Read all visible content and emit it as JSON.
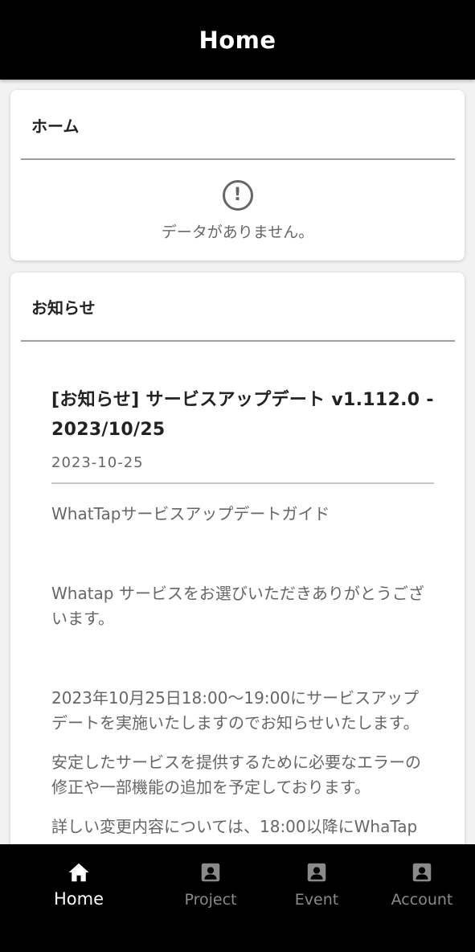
{
  "header": {
    "title": "Home"
  },
  "home_card": {
    "title": "ホーム",
    "empty_icon": "alert-circle-icon",
    "empty_text": "データがありません。"
  },
  "notice_card": {
    "title": "お知らせ",
    "item": {
      "title": "[お知らせ] サービスアップデート v1.112.0 - 2023/10/25",
      "date": "2023-10-25",
      "body": [
        "WhatTapサービスアップデートガイド",
        "Whatap サービスをお選びいただきありがとうございます。",
        "2023年10月25日18:00～19:00にサービスアップデートを実施いたしますのでお知らせいたします。",
        "安定したサービスを提供するために必要なエラーの修正や一部機能の追加を予定しております。",
        "詳しい変更内容については、18:00以降にWhaTap"
      ]
    }
  },
  "bottom_nav": {
    "items": [
      {
        "label": "Home",
        "icon": "home-icon",
        "active": true
      },
      {
        "label": "Project",
        "icon": "account-box-icon",
        "active": false
      },
      {
        "label": "Event",
        "icon": "account-box-icon",
        "active": false
      },
      {
        "label": "Account",
        "icon": "account-box-icon",
        "active": false
      }
    ]
  },
  "colors": {
    "header_bg": "#000000",
    "nav_active": "#ffffff",
    "nav_inactive": "#8a8a8a",
    "muted_text": "#666666"
  }
}
